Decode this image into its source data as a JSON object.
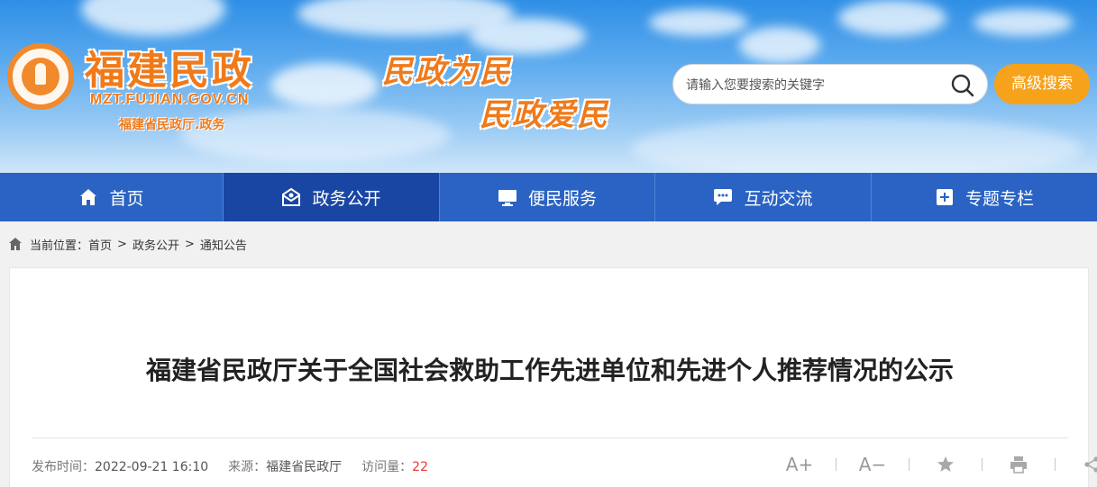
{
  "header": {
    "site_name": "福建民政",
    "site_domain": "MZT.FUJIAN.GOV.CN",
    "site_sub": "福建省民政厅.政务",
    "slogan_1": "民政为民",
    "slogan_2": "民政爱民",
    "search_placeholder": "请输入您要搜索的关键字",
    "advanced_search_label": "高级搜索"
  },
  "nav": {
    "items": [
      {
        "label": "首页",
        "icon": "home-icon"
      },
      {
        "label": "政务公开",
        "icon": "gov-icon",
        "active": true
      },
      {
        "label": "便民服务",
        "icon": "monitor-icon"
      },
      {
        "label": "互动交流",
        "icon": "chat-icon"
      },
      {
        "label": "专题专栏",
        "icon": "bookmark-plus-icon"
      }
    ]
  },
  "breadcrumb": {
    "prefix": "当前位置：",
    "items": [
      "首页",
      "政务公开",
      "通知公告"
    ],
    "separator": ">"
  },
  "article": {
    "title": "福建省民政厅关于全国社会救助工作先进单位和先进个人推荐情况的公示",
    "publish_label": "发布时间：",
    "publish_time": "2022-09-21 16:10",
    "source_label": "来源：",
    "source": "福建省民政厅",
    "views_label": "访问量：",
    "views": "22"
  },
  "tools": {
    "font_larger": "A+",
    "font_smaller": "A−"
  },
  "colors": {
    "accent_orange": "#f07a1a",
    "nav_blue": "#2a63c3",
    "nav_active": "#1a46a3",
    "button_orange": "#f7a21b"
  }
}
